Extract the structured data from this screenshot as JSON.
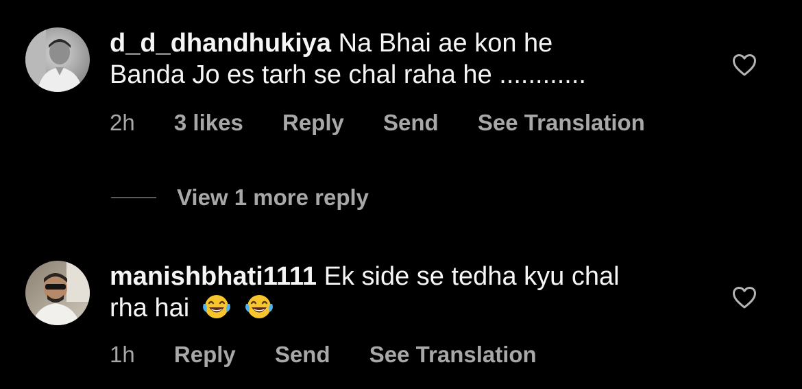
{
  "comments": [
    {
      "username": "d_d_dhandhukiya",
      "text_line1": "Na Bhai ae kon he",
      "text_line2": "Banda Jo es tarh se chal raha he ............",
      "emojis": "",
      "time": "2h",
      "likes": "3 likes",
      "reply_label": "Reply",
      "send_label": "Send",
      "translate_label": "See Translation",
      "avatar_icon": "user-avatar-photo",
      "like_icon": "heart-outline-icon"
    },
    {
      "username": "manishbhati1111",
      "text_line1": "Ek side se tedha kyu chal",
      "text_line2": "rha hai",
      "emojis": "😂😂",
      "time": "1h",
      "reply_label": "Reply",
      "send_label": "Send",
      "translate_label": "See Translation",
      "avatar_icon": "user-avatar-photo",
      "like_icon": "heart-outline-icon"
    }
  ],
  "view_replies": {
    "label": "View 1 more reply"
  },
  "colors": {
    "background": "#000000",
    "primary_text": "#f5f5f5",
    "secondary_text": "#a8a8a8",
    "divider": "#5a5a5a"
  }
}
